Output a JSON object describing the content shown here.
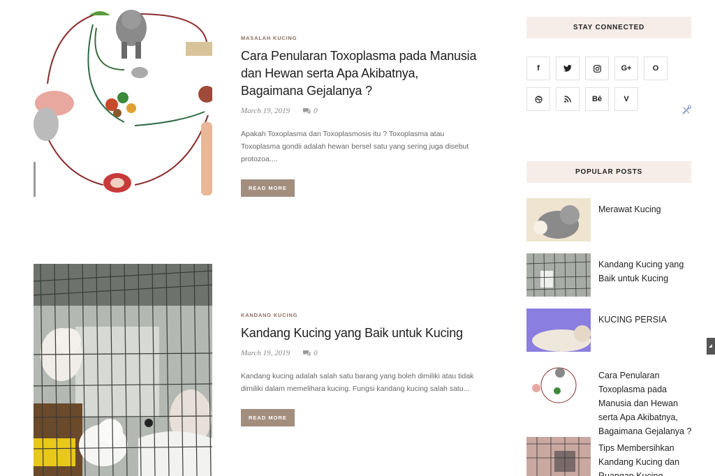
{
  "posts": [
    {
      "category": "MASALAH KUCING",
      "title": "Cara Penularan Toxoplasma pada Manusia dan Hewan serta Apa Akibatnya, Bagaimana Gejalanya ?",
      "date": "March 19, 2019",
      "comments": "0",
      "excerpt": "Apakah Toxoplasma dan Toxoplasmosis itu ? Toxoplasma atau Toxoplasma gondii adalah hewan bersel satu yang sering juga disebut protozoa....",
      "button": "READ MORE"
    },
    {
      "category": "KANDANG KUCING",
      "title": "Kandang Kucing yang Baik untuk Kucing",
      "date": "March 19, 2019",
      "comments": "0",
      "excerpt": "Kandang kucing adalah salah satu barang yang boleh dimiliki atau tidak dimiliki dalam memelihara kucing. Fungsi kandang kucing salah satu...",
      "button": "READ MORE"
    }
  ],
  "sidebar": {
    "stay_connected": "STAY CONNECTED",
    "social_icons": [
      "facebook-icon",
      "twitter-icon",
      "instagram-icon",
      "google-plus-icon",
      "opera-icon",
      "dribbble-icon",
      "rss-icon",
      "behance-icon",
      "vimeo-icon"
    ],
    "social_labels": [
      "f",
      "🐦",
      "◎",
      "G+",
      "O",
      "⊕",
      "☰",
      "Bē",
      "V"
    ],
    "popular_posts_title": "POPULAR POSTS",
    "popular_posts": [
      "Merawat Kucing",
      "Kandang Kucing yang Baik untuk Kucing",
      "KUCING PERSIA",
      "Cara Penularan Toxoplasma pada Manusia dan Hewan serta Apa Akibatnya, Bagaimana Gejalanya ?",
      "Tips Membersihkan Kandang Kucing dan Ruangan Kucing"
    ]
  },
  "colors": {
    "accent": "#a38d7c",
    "widget_bg": "#f7ede8",
    "category": "#8c6e5c"
  }
}
